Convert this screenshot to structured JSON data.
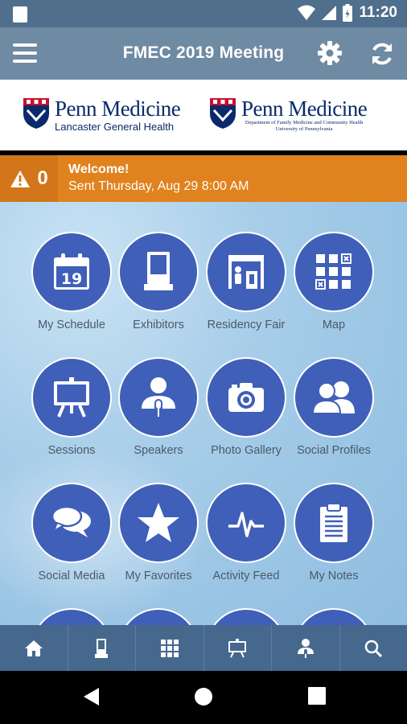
{
  "status_bar": {
    "time": "11:20"
  },
  "app_bar": {
    "title": "FMEC 2019 Meeting"
  },
  "logos": {
    "left": {
      "brand": "Penn Medicine",
      "sub": "Lancaster General Health"
    },
    "right": {
      "brand": "Penn Medicine",
      "sub_line1": "Department of Family Medicine and Community Health",
      "sub_line2": "University of Pennsylvania"
    }
  },
  "alert": {
    "count": "0",
    "title": "Welcome!",
    "time": "Sent Thursday, Aug 29 8:00 AM"
  },
  "tiles": [
    {
      "label": "My Schedule",
      "icon": "calendar-icon",
      "date": "19"
    },
    {
      "label": "Exhibitors",
      "icon": "booth-icon"
    },
    {
      "label": "Residency Fair",
      "icon": "fair-booth-icon"
    },
    {
      "label": "Map",
      "icon": "map-grid-icon"
    },
    {
      "label": "Sessions",
      "icon": "easel-icon"
    },
    {
      "label": "Speakers",
      "icon": "speaker-icon"
    },
    {
      "label": "Photo Gallery",
      "icon": "camera-icon"
    },
    {
      "label": "Social Profiles",
      "icon": "people-icon"
    },
    {
      "label": "Social Media",
      "icon": "chat-bubbles-icon"
    },
    {
      "label": "My Favorites",
      "icon": "star-icon"
    },
    {
      "label": "Activity Feed",
      "icon": "pulse-icon"
    },
    {
      "label": "My Notes",
      "icon": "clipboard-icon"
    }
  ],
  "bottom_nav": [
    {
      "icon": "home-icon"
    },
    {
      "icon": "booth-icon"
    },
    {
      "icon": "map-grid-icon"
    },
    {
      "icon": "easel-icon"
    },
    {
      "icon": "speaker-icon"
    },
    {
      "icon": "search-icon"
    }
  ],
  "colors": {
    "app_bar": "#6f8aa3",
    "status_bar": "#4f6f8c",
    "alert": "#e0821e",
    "tile": "#3f5fb9",
    "bottom_nav": "#46688c"
  }
}
